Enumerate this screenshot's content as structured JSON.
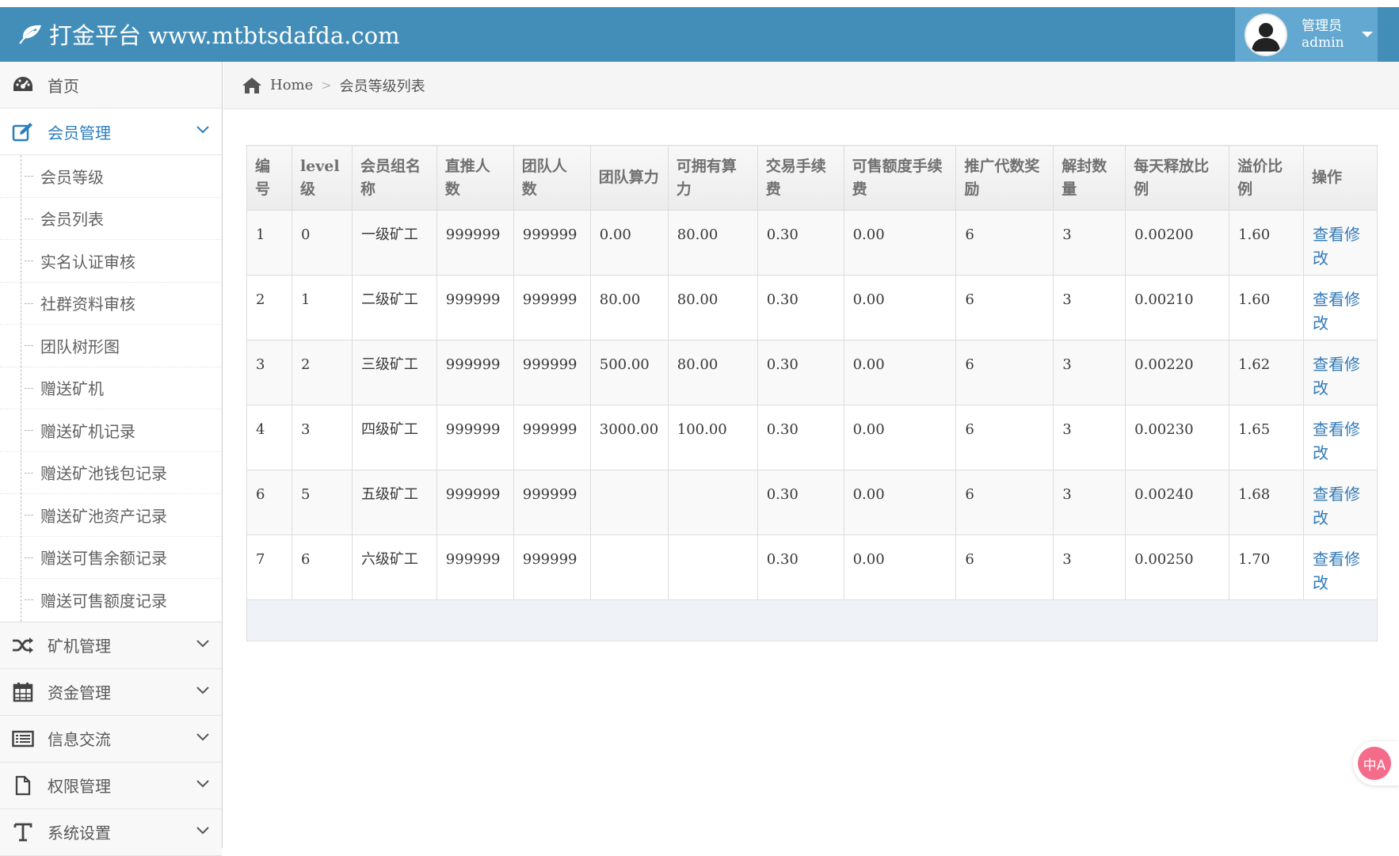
{
  "header": {
    "brand_text": "打金平台 www.mtbtsdafda.com",
    "user_role": "管理员",
    "user_name": "admin"
  },
  "sidebar": {
    "items": [
      {
        "label": "首页",
        "icon": "dashboard-icon"
      },
      {
        "label": "会员管理",
        "icon": "edit-icon",
        "open": true,
        "children": [
          "会员等级",
          "会员列表",
          "实名认证审核",
          "社群资料审核",
          "团队树形图",
          "赠送矿机",
          "赠送矿机记录",
          "赠送矿池钱包记录",
          "赠送矿池资产记录",
          "赠送可售余额记录",
          "赠送可售额度记录"
        ]
      },
      {
        "label": "矿机管理",
        "icon": "shuffle-icon"
      },
      {
        "label": "资金管理",
        "icon": "calendar-icon"
      },
      {
        "label": "信息交流",
        "icon": "list-icon"
      },
      {
        "label": "权限管理",
        "icon": "file-icon"
      },
      {
        "label": "系统设置",
        "icon": "text-icon"
      }
    ]
  },
  "breadcrumb": {
    "home": "Home",
    "current": "会员等级列表"
  },
  "table": {
    "headers": [
      "编号",
      "level级",
      "会员组名称",
      "直推人数",
      "团队人数",
      "团队算力",
      "可拥有算力",
      "交易手续费",
      "可售额度手续费",
      "推广代数奖励",
      "解封数量",
      "每天释放比例",
      "溢价比例",
      "操作"
    ],
    "rows": [
      [
        "1",
        "0",
        "一级矿工",
        "999999",
        "999999",
        "0.00",
        "80.00",
        "0.30",
        "0.00",
        "6",
        "3",
        "0.00200",
        "1.60",
        "查看修改"
      ],
      [
        "2",
        "1",
        "二级矿工",
        "999999",
        "999999",
        "80.00",
        "80.00",
        "0.30",
        "0.00",
        "6",
        "3",
        "0.00210",
        "1.60",
        "查看修改"
      ],
      [
        "3",
        "2",
        "三级矿工",
        "999999",
        "999999",
        "500.00",
        "80.00",
        "0.30",
        "0.00",
        "6",
        "3",
        "0.00220",
        "1.62",
        "查看修改"
      ],
      [
        "4",
        "3",
        "四级矿工",
        "999999",
        "999999",
        "3000.00",
        "100.00",
        "0.30",
        "0.00",
        "6",
        "3",
        "0.00230",
        "1.65",
        "查看修改"
      ],
      [
        "6",
        "5",
        "五级矿工",
        "999999",
        "999999",
        "",
        "",
        "0.30",
        "0.00",
        "6",
        "3",
        "0.00240",
        "1.68",
        "查看修改"
      ],
      [
        "7",
        "6",
        "六级矿工",
        "999999",
        "999999",
        "",
        "",
        "0.30",
        "0.00",
        "6",
        "3",
        "0.00250",
        "1.70",
        "查看修改"
      ]
    ]
  },
  "float_button": {
    "label": "中A",
    "icon": "translate-icon"
  },
  "colors": {
    "navbar": "#438eb9",
    "user_box": "#62a8d1",
    "link": "#337ab7",
    "active_menu": "#2b7dbc"
  }
}
